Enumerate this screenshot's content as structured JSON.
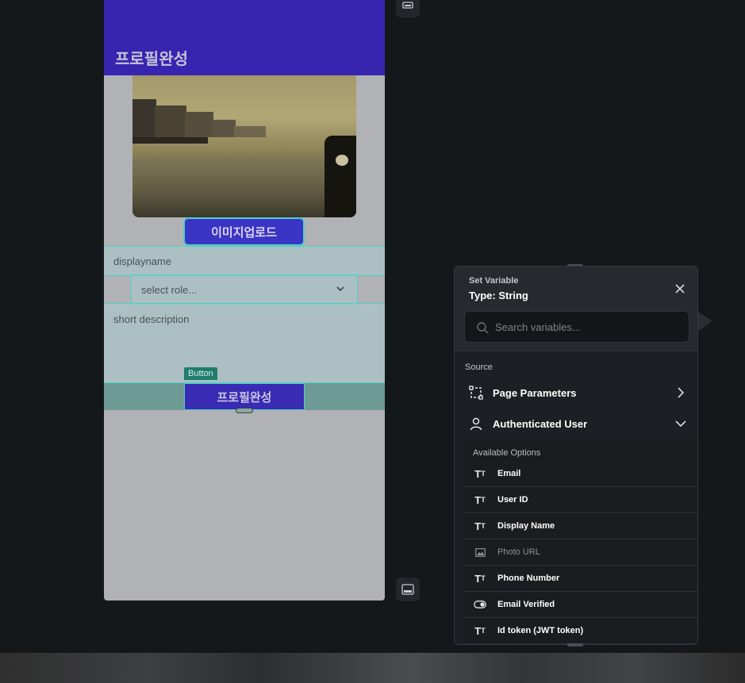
{
  "phone": {
    "appbar_title": "프로필완성",
    "upload_button": "이미지업로드",
    "displayname_placeholder": "displayname",
    "role_placeholder": "select role...",
    "description_placeholder": "short description",
    "button_tag": "Button",
    "complete_button": "프로필완성"
  },
  "panel": {
    "subtitle": "Set Variable",
    "title": "Type: String",
    "search_placeholder": "Search variables...",
    "source_label": "Source",
    "sources": [
      {
        "label": "Page Parameters",
        "icon": "page-parameters-icon",
        "state": "collapsed"
      },
      {
        "label": "Authenticated User",
        "icon": "user-icon",
        "state": "expanded"
      }
    ],
    "available_label": "Available Options",
    "options": [
      {
        "label": "Email",
        "icon": "text-type-icon",
        "enabled": true
      },
      {
        "label": "User ID",
        "icon": "text-type-icon",
        "enabled": true
      },
      {
        "label": "Display Name",
        "icon": "text-type-icon",
        "enabled": true
      },
      {
        "label": "Photo URL",
        "icon": "image-icon",
        "enabled": false
      },
      {
        "label": "Phone Number",
        "icon": "text-type-icon",
        "enabled": true
      },
      {
        "label": "Email Verified",
        "icon": "toggle-icon",
        "enabled": true
      },
      {
        "label": "Id token (JWT token)",
        "icon": "text-type-icon",
        "enabled": true
      }
    ]
  },
  "colors": {
    "appbar": "#3725b0",
    "accent_outline": "#4fd1c5",
    "panel_bg": "#1c1f23",
    "canvas_bg": "#15181b"
  }
}
